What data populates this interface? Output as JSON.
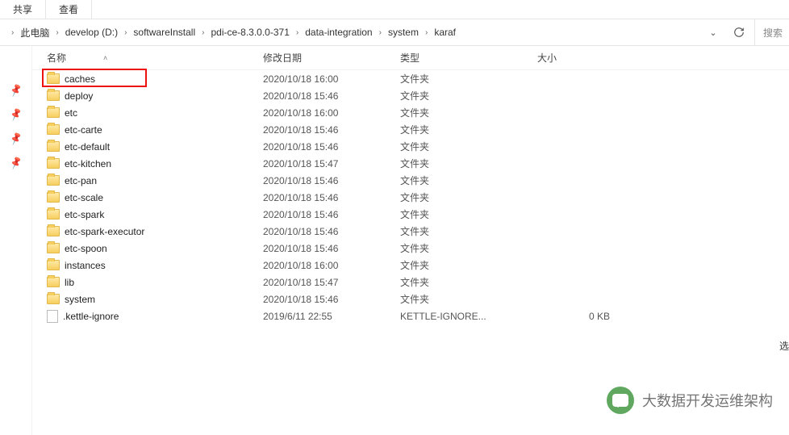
{
  "tabs": {
    "share": "共享",
    "view": "查看"
  },
  "breadcrumb": [
    "此电脑",
    "develop (D:)",
    "softwareInstall",
    "pdi-ce-8.3.0.0-371",
    "data-integration",
    "system",
    "karaf"
  ],
  "search": {
    "placeholder": "搜索"
  },
  "columns": {
    "name": "名称",
    "date": "修改日期",
    "type": "类型",
    "size": "大小"
  },
  "files": [
    {
      "icon": "folder",
      "name": "caches",
      "date": "2020/10/18 16:00",
      "type": "文件夹",
      "size": ""
    },
    {
      "icon": "folder",
      "name": "deploy",
      "date": "2020/10/18 15:46",
      "type": "文件夹",
      "size": ""
    },
    {
      "icon": "folder",
      "name": "etc",
      "date": "2020/10/18 16:00",
      "type": "文件夹",
      "size": ""
    },
    {
      "icon": "folder",
      "name": "etc-carte",
      "date": "2020/10/18 15:46",
      "type": "文件夹",
      "size": ""
    },
    {
      "icon": "folder",
      "name": "etc-default",
      "date": "2020/10/18 15:46",
      "type": "文件夹",
      "size": ""
    },
    {
      "icon": "folder",
      "name": "etc-kitchen",
      "date": "2020/10/18 15:47",
      "type": "文件夹",
      "size": ""
    },
    {
      "icon": "folder",
      "name": "etc-pan",
      "date": "2020/10/18 15:46",
      "type": "文件夹",
      "size": ""
    },
    {
      "icon": "folder",
      "name": "etc-scale",
      "date": "2020/10/18 15:46",
      "type": "文件夹",
      "size": ""
    },
    {
      "icon": "folder",
      "name": "etc-spark",
      "date": "2020/10/18 15:46",
      "type": "文件夹",
      "size": ""
    },
    {
      "icon": "folder",
      "name": "etc-spark-executor",
      "date": "2020/10/18 15:46",
      "type": "文件夹",
      "size": ""
    },
    {
      "icon": "folder",
      "name": "etc-spoon",
      "date": "2020/10/18 15:46",
      "type": "文件夹",
      "size": ""
    },
    {
      "icon": "folder",
      "name": "instances",
      "date": "2020/10/18 16:00",
      "type": "文件夹",
      "size": ""
    },
    {
      "icon": "folder",
      "name": "lib",
      "date": "2020/10/18 15:47",
      "type": "文件夹",
      "size": ""
    },
    {
      "icon": "folder",
      "name": "system",
      "date": "2020/10/18 15:46",
      "type": "文件夹",
      "size": ""
    },
    {
      "icon": "file",
      "name": ".kettle-ignore",
      "date": "2019/6/11 22:55",
      "type": "KETTLE-IGNORE...",
      "size": "0 KB"
    }
  ],
  "highlight_index": 0,
  "side_label": "选",
  "watermark": "大数据开发运维架构"
}
